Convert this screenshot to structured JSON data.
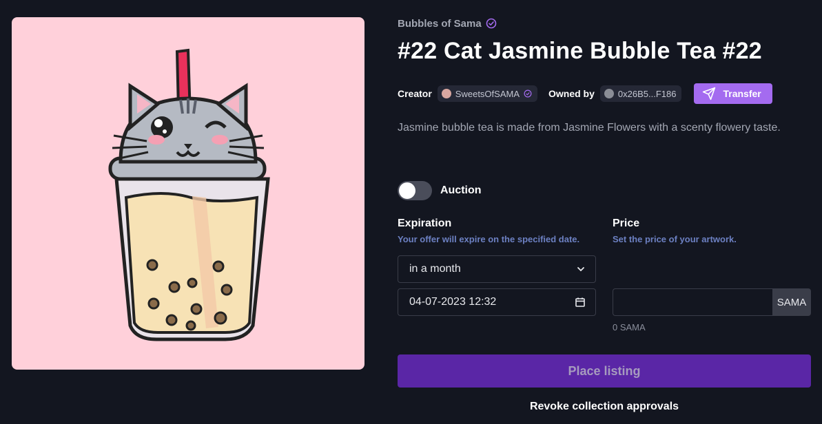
{
  "collection": {
    "name": "Bubbles of Sama"
  },
  "nft": {
    "title": "#22 Cat Jasmine Bubble Tea #22",
    "description": "Jasmine bubble tea is made from Jasmine Flowers with a scenty flowery taste."
  },
  "meta": {
    "creator_label": "Creator",
    "creator_name": "SweetsOfSAMA",
    "owner_label": "Owned by",
    "owner_address": "0x26B5...F186",
    "transfer_label": "Transfer"
  },
  "auction": {
    "label": "Auction",
    "enabled": false
  },
  "expiration": {
    "heading": "Expiration",
    "help": "Your offer will expire on the specified date.",
    "selected_option": "in a month",
    "date_value": "04-07-2023 12:32"
  },
  "price": {
    "heading": "Price",
    "help": "Set the price of your artwork.",
    "value": "",
    "currency": "SAMA",
    "converted": "0 SAMA"
  },
  "actions": {
    "place_listing": "Place listing",
    "revoke": "Revoke collection approvals"
  },
  "colors": {
    "background": "#131620",
    "accent": "#a46bf0",
    "primary_button": "#5a26a6",
    "artwork_bg": "#ffd0da"
  }
}
